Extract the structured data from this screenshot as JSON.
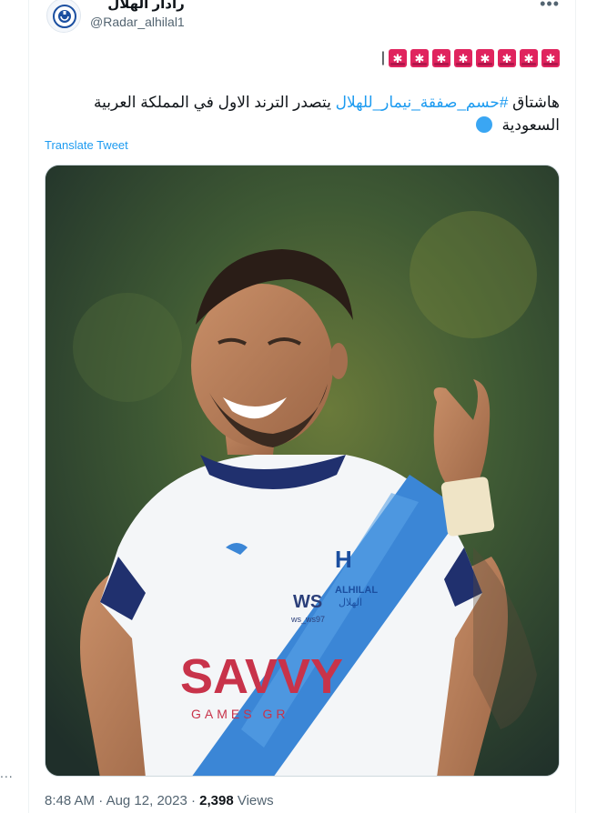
{
  "author": {
    "display_name": "رادار الهلال",
    "handle": "@Radar_alhilal1",
    "avatar_icon": "hilal-crest-icon"
  },
  "more_label": "•••",
  "sirens": {
    "count": 8,
    "icon": "police-siren-icon",
    "trailing_mark": "|"
  },
  "tweet": {
    "text_before": "هاشتاق ",
    "hashtag": "#حسم_صفقة_نيمار_للهلال",
    "text_after": " يتصدر الترند الاول في المملكة العربية السعودية",
    "end_icon": "blue-circle-icon"
  },
  "translate_label": "Translate Tweet",
  "media": {
    "alt_subject": "player-photo",
    "jersey_sponsor": "SAVVY",
    "jersey_sponsor_sub": "GAMES GR",
    "club_text": "ALHILAL",
    "club_arabic": "الهلال",
    "ws_text": "WS",
    "ws_sub": "ws_ws97"
  },
  "meta": {
    "time": "8:48 AM",
    "separator": " · ",
    "date": "Aug 12, 2023",
    "views_count": "2,398",
    "views_label": " Views"
  },
  "left_rail_dots": "..."
}
